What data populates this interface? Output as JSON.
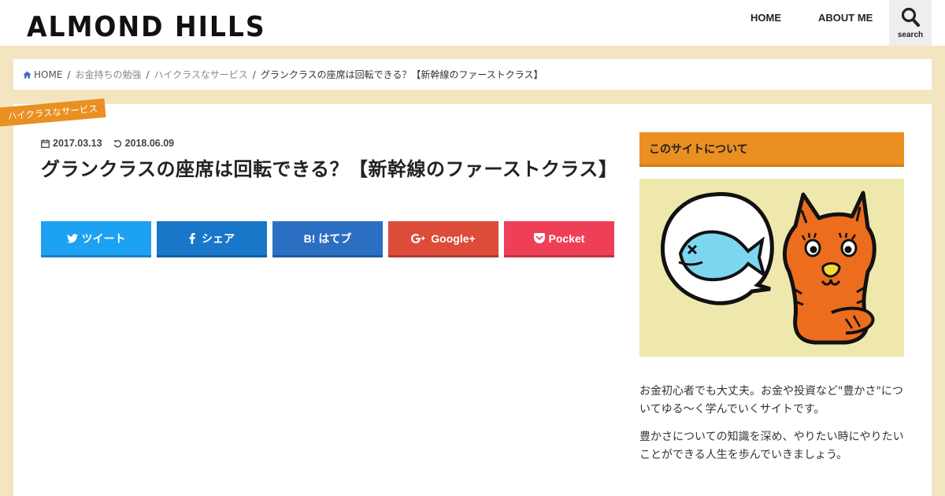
{
  "header": {
    "logo": "ALMOND HILLS",
    "nav": [
      "HOME",
      "ABOUT ME"
    ],
    "search_label": "search"
  },
  "breadcrumb": {
    "items": [
      "HOME",
      "お金持ちの勉強",
      "ハイクラスなサービス"
    ],
    "current": "グランクラスの座席は回転できる？【新幹線のファーストクラス】"
  },
  "article": {
    "category": "ハイクラスなサービス",
    "published": "2017.03.13",
    "updated": "2018.06.09",
    "title": "グランクラスの座席は回転できる？【新幹線のファーストクラス】"
  },
  "share": {
    "twitter": "ツイート",
    "facebook": "シェア",
    "hatena_mark": "B!",
    "hatena": "はてブ",
    "google": "Google+",
    "pocket": "Pocket"
  },
  "sidebar": {
    "heading": "このサイトについて",
    "paragraphs": [
      "お金初心者でも大丈夫。お金や投資など\"豊かさ\"についてゆる〜く学んでいくサイトです。",
      "豊かさについての知識を深め、やりたい時にやりたいことができる人生を歩んでいきましょう。"
    ]
  },
  "colors": {
    "background": "#f3e5c0",
    "accent": "#ea8f21",
    "twitter": "#1da1f2",
    "facebook": "#1877c9",
    "hatena": "#2b6fc2",
    "google": "#dd4b39",
    "pocket": "#ef3f56"
  },
  "icons": [
    "search-icon",
    "home-icon",
    "pin-icon",
    "calendar-icon",
    "refresh-icon",
    "twitter-icon",
    "facebook-icon",
    "google-plus-icon",
    "pocket-icon"
  ]
}
